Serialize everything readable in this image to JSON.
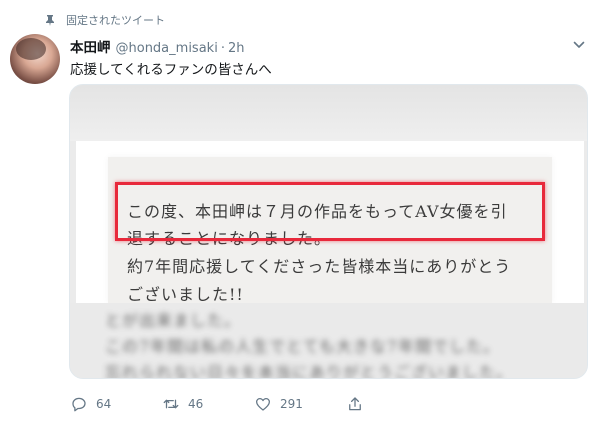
{
  "pinned": {
    "label": "固定されたツイート",
    "icon": "pin-icon"
  },
  "author": {
    "name": "本田岬",
    "handle": "@honda_misaki",
    "separator": "·",
    "time": "2h"
  },
  "tweet": {
    "text": "応援してくれるファンの皆さんへ"
  },
  "media": {
    "letter_lines": [
      "この度、本田岬は７月の作品をもってAV女優を引",
      "退することになりました。",
      "約7年間応援してくださった皆様本当にありがとう",
      "ございました!!"
    ],
    "blurred_lines": [
      "とが出来ました。",
      "この7年間は私の人生でとても大きな7年間でした。",
      "忘れられない日々を本当にありがとうございました。"
    ],
    "highlight_color": "#e8293b"
  },
  "actions": {
    "reply": {
      "icon": "reply-icon",
      "count": "64"
    },
    "retweet": {
      "icon": "retweet-icon",
      "count": "46"
    },
    "like": {
      "icon": "heart-icon",
      "count": "291"
    },
    "share": {
      "icon": "share-icon"
    }
  },
  "colors": {
    "secondary_text": "#657786",
    "primary_text": "#14171a",
    "border": "#e1e8ed"
  }
}
